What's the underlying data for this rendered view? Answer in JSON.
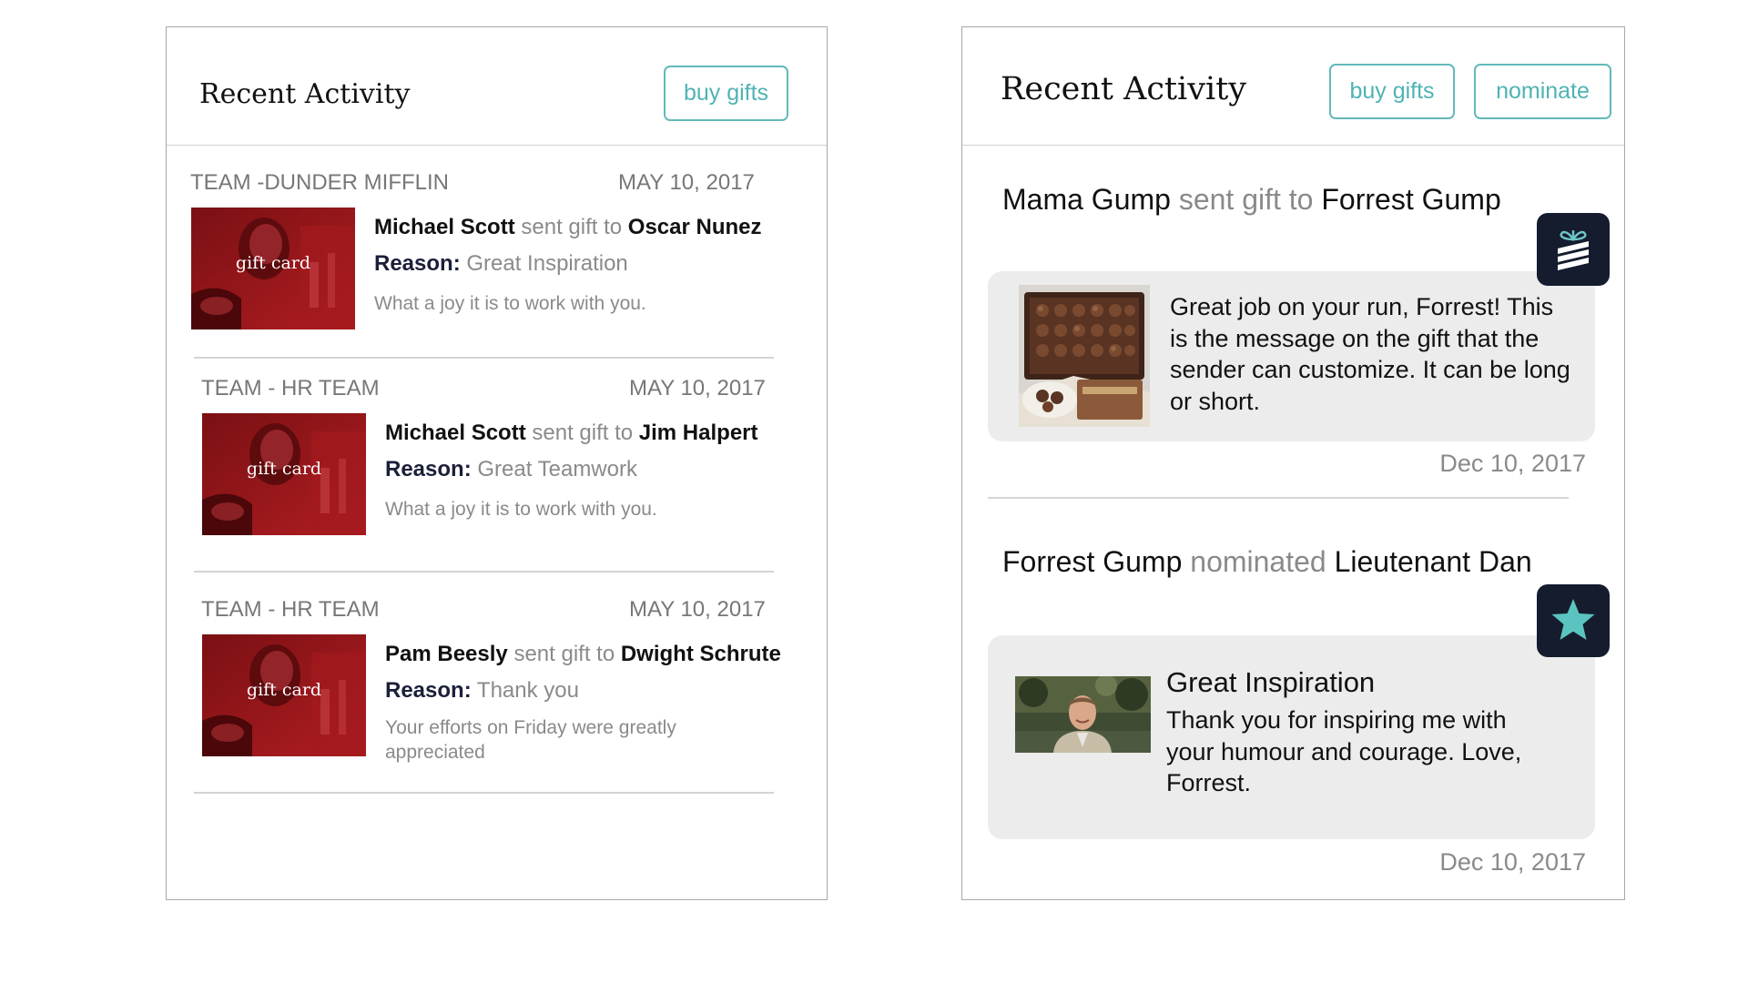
{
  "left_panel": {
    "title": "Recent Activity",
    "buy_gifts_label": "buy gifts",
    "items": [
      {
        "team": "TEAM -DUNDER MIFFLIN",
        "date": "MAY 10, 2017",
        "thumb_label": "gift card",
        "sender": "Michael Scott",
        "verb": "sent gift to",
        "recipient": "Oscar Nunez",
        "reason_label": "Reason:",
        "reason": "Great Inspiration",
        "message": "What a joy it is to work with you."
      },
      {
        "team": "TEAM - HR TEAM",
        "date": "MAY 10, 2017",
        "thumb_label": "gift card",
        "sender": "Michael Scott",
        "verb": "sent gift to",
        "recipient": "Jim Halpert",
        "reason_label": "Reason:",
        "reason": "Great Teamwork",
        "message": "What a joy it is to work with you."
      },
      {
        "team": "TEAM - HR TEAM",
        "date": "MAY 10, 2017",
        "thumb_label": "gift card",
        "sender": "Pam Beesly",
        "verb": "sent gift to",
        "recipient": "Dwight Schrute",
        "reason_label": "Reason:",
        "reason": "Thank you",
        "message": "Your efforts on Friday were greatly appreciated"
      }
    ]
  },
  "right_panel": {
    "title": "Recent Activity",
    "buy_gifts_label": "buy gifts",
    "nominate_label": "nominate",
    "items": [
      {
        "actor": "Mama Gump",
        "verb": "sent gift to",
        "target": "Forrest Gump",
        "badge_icon": "gift-icon",
        "photo": "chocolate-box",
        "message": "Great job on your run, Forrest! This is the message on the gift that the sender can customize. It can be long or short.",
        "date": "Dec 10, 2017"
      },
      {
        "actor": "Forrest Gump",
        "verb": "nominated",
        "target": "Lieutenant Dan",
        "badge_icon": "star-icon",
        "photo": "portrait",
        "heading": "Great Inspiration",
        "message": "Thank you for inspiring me with your humour and courage. Love, Forrest.",
        "date": "Dec 10, 2017"
      }
    ]
  },
  "colors": {
    "accent": "#4fb3b3",
    "badge_bg": "#141c2e",
    "card_bg": "#ececec",
    "gift_card_red": "#8b1518"
  }
}
